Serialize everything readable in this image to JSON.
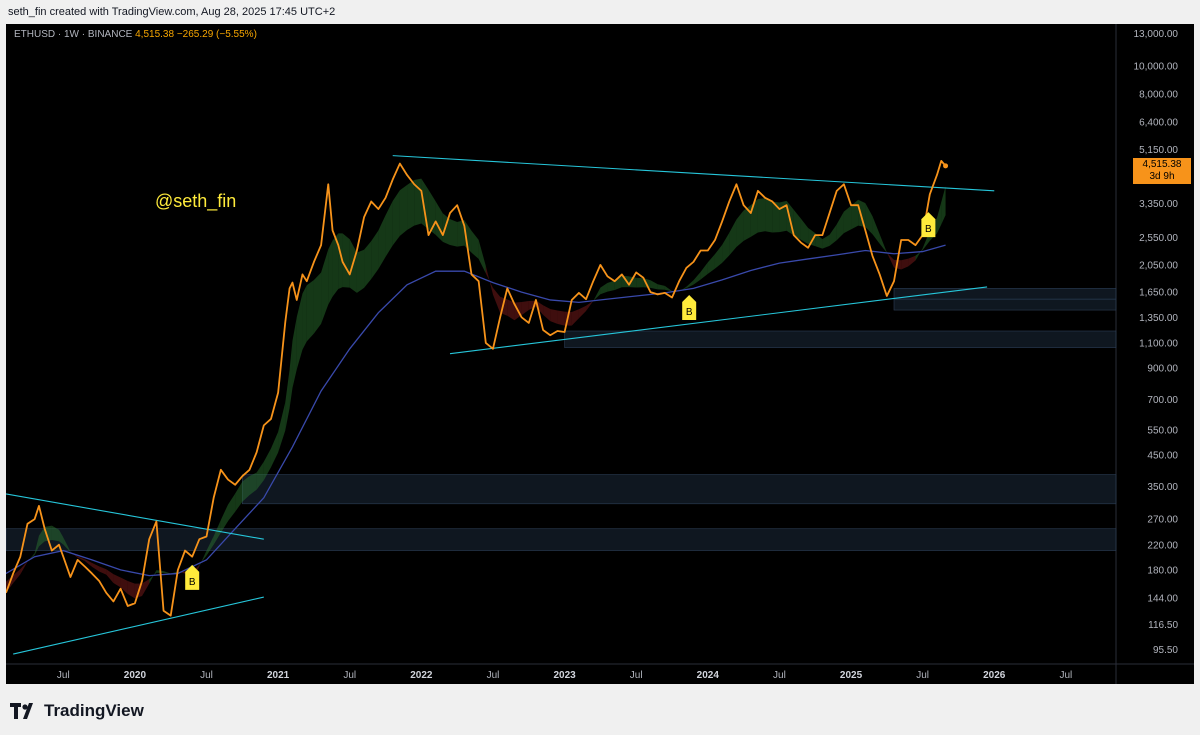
{
  "header": {
    "caption": "seth_fin created with TradingView.com, Aug 28, 2025 17:45 UTC+2"
  },
  "legend": {
    "symbol": "ETHUSD · 1W · BINANCE",
    "price": "4,515.38",
    "change": "−265.29 (−5.55%)"
  },
  "watermark_user": "@seth_fin",
  "price_tag": {
    "price": "4,515.38",
    "countdown": "3d 9h"
  },
  "footer": {
    "brand": "TradingView",
    "logo_icon": "tradingview-logo-icon"
  },
  "signal_badges": [
    "B",
    "B",
    "B"
  ],
  "colors": {
    "price_line": "#f7931a",
    "trendline": "#26c6da",
    "ma_slow": "#3949ab",
    "cloud_bull": "#2e7d32",
    "cloud_bear": "#8b1e1e",
    "badge": "#ffeb3b",
    "zone": "#1c2a3a"
  },
  "chart_data": {
    "type": "line",
    "scale": "log",
    "ylim": [
      85,
      14000
    ],
    "y_ticks": [
      "13,000.00",
      "10,000.00",
      "8,000.00",
      "6,400.00",
      "5,150.00",
      "3,350.00",
      "2,550.00",
      "2,050.00",
      "1,650.00",
      "1,350.00",
      "1,100.00",
      "900.00",
      "700.00",
      "550.00",
      "450.00",
      "350.00",
      "270.00",
      "220.00",
      "180.00",
      "144.00",
      "116.50",
      "95.50"
    ],
    "y_tick_values": [
      13000,
      10000,
      8000,
      6400,
      5150,
      3350,
      2550,
      2050,
      1650,
      1350,
      1100,
      900,
      700,
      550,
      450,
      350,
      270,
      220,
      180,
      144,
      116.5,
      95.5
    ],
    "x_ticks": [
      "Jul",
      "2020",
      "Jul",
      "2021",
      "Jul",
      "2022",
      "Jul",
      "2023",
      "Jul",
      "2024",
      "Jul",
      "2025",
      "Jul",
      "2026",
      "Jul"
    ],
    "x_tick_values": [
      2019.5,
      2020.0,
      2020.5,
      2021.0,
      2021.5,
      2022.0,
      2022.5,
      2023.0,
      2023.5,
      2024.0,
      2024.5,
      2025.0,
      2025.5,
      2026.0,
      2026.5
    ],
    "xlim": [
      2019.1,
      2026.85
    ],
    "series": [
      {
        "points": [
          [
            2019.1,
            150
          ],
          [
            2019.15,
            175
          ],
          [
            2019.2,
            200
          ],
          [
            2019.25,
            260
          ],
          [
            2019.3,
            270
          ],
          [
            2019.33,
            300
          ],
          [
            2019.37,
            250
          ],
          [
            2019.42,
            210
          ],
          [
            2019.47,
            220
          ],
          [
            2019.5,
            200
          ],
          [
            2019.55,
            170
          ],
          [
            2019.6,
            195
          ],
          [
            2019.65,
            185
          ],
          [
            2019.7,
            175
          ],
          [
            2019.75,
            165
          ],
          [
            2019.8,
            150
          ],
          [
            2019.85,
            140
          ],
          [
            2019.9,
            155
          ],
          [
            2019.95,
            135
          ],
          [
            2020.0,
            138
          ],
          [
            2020.05,
            165
          ],
          [
            2020.1,
            230
          ],
          [
            2020.15,
            265
          ],
          [
            2020.2,
            130
          ],
          [
            2020.25,
            125
          ],
          [
            2020.3,
            180
          ],
          [
            2020.35,
            210
          ],
          [
            2020.4,
            200
          ],
          [
            2020.45,
            230
          ],
          [
            2020.5,
            235
          ],
          [
            2020.55,
            320
          ],
          [
            2020.6,
            400
          ],
          [
            2020.65,
            370
          ],
          [
            2020.7,
            355
          ],
          [
            2020.75,
            380
          ],
          [
            2020.8,
            400
          ],
          [
            2020.85,
            460
          ],
          [
            2020.9,
            570
          ],
          [
            2020.95,
            600
          ],
          [
            2021.0,
            740
          ],
          [
            2021.05,
            1300
          ],
          [
            2021.08,
            1700
          ],
          [
            2021.1,
            1780
          ],
          [
            2021.13,
            1550
          ],
          [
            2021.17,
            1900
          ],
          [
            2021.2,
            1800
          ],
          [
            2021.25,
            2100
          ],
          [
            2021.3,
            2400
          ],
          [
            2021.35,
            3900
          ],
          [
            2021.38,
            2700
          ],
          [
            2021.42,
            2400
          ],
          [
            2021.45,
            2100
          ],
          [
            2021.5,
            1900
          ],
          [
            2021.55,
            2300
          ],
          [
            2021.6,
            3000
          ],
          [
            2021.65,
            3400
          ],
          [
            2021.7,
            3200
          ],
          [
            2021.75,
            3500
          ],
          [
            2021.8,
            4050
          ],
          [
            2021.85,
            4600
          ],
          [
            2021.9,
            4200
          ],
          [
            2021.95,
            3900
          ],
          [
            2022.0,
            3700
          ],
          [
            2022.05,
            2600
          ],
          [
            2022.1,
            2900
          ],
          [
            2022.15,
            2600
          ],
          [
            2022.2,
            3100
          ],
          [
            2022.25,
            3300
          ],
          [
            2022.3,
            2800
          ],
          [
            2022.35,
            1900
          ],
          [
            2022.4,
            1800
          ],
          [
            2022.45,
            1100
          ],
          [
            2022.5,
            1050
          ],
          [
            2022.55,
            1350
          ],
          [
            2022.6,
            1700
          ],
          [
            2022.65,
            1500
          ],
          [
            2022.7,
            1350
          ],
          [
            2022.75,
            1290
          ],
          [
            2022.8,
            1550
          ],
          [
            2022.85,
            1220
          ],
          [
            2022.9,
            1170
          ],
          [
            2022.95,
            1210
          ],
          [
            2023.0,
            1200
          ],
          [
            2023.05,
            1550
          ],
          [
            2023.1,
            1640
          ],
          [
            2023.15,
            1560
          ],
          [
            2023.2,
            1800
          ],
          [
            2023.25,
            2050
          ],
          [
            2023.3,
            1870
          ],
          [
            2023.35,
            1800
          ],
          [
            2023.4,
            1900
          ],
          [
            2023.45,
            1750
          ],
          [
            2023.5,
            1930
          ],
          [
            2023.55,
            1850
          ],
          [
            2023.6,
            1650
          ],
          [
            2023.65,
            1620
          ],
          [
            2023.7,
            1640
          ],
          [
            2023.75,
            1580
          ],
          [
            2023.8,
            1800
          ],
          [
            2023.85,
            2000
          ],
          [
            2023.9,
            2100
          ],
          [
            2023.95,
            2300
          ],
          [
            2024.0,
            2300
          ],
          [
            2024.05,
            2500
          ],
          [
            2024.1,
            2900
          ],
          [
            2024.15,
            3400
          ],
          [
            2024.2,
            3900
          ],
          [
            2024.25,
            3300
          ],
          [
            2024.3,
            3100
          ],
          [
            2024.35,
            3700
          ],
          [
            2024.4,
            3500
          ],
          [
            2024.45,
            3400
          ],
          [
            2024.5,
            3200
          ],
          [
            2024.55,
            3300
          ],
          [
            2024.6,
            2600
          ],
          [
            2024.65,
            2450
          ],
          [
            2024.7,
            2350
          ],
          [
            2024.75,
            2600
          ],
          [
            2024.8,
            2600
          ],
          [
            2024.85,
            3100
          ],
          [
            2024.9,
            3700
          ],
          [
            2024.95,
            3900
          ],
          [
            2025.0,
            3300
          ],
          [
            2025.05,
            3300
          ],
          [
            2025.1,
            2700
          ],
          [
            2025.15,
            2200
          ],
          [
            2025.2,
            1900
          ],
          [
            2025.25,
            1600
          ],
          [
            2025.3,
            1800
          ],
          [
            2025.35,
            2500
          ],
          [
            2025.4,
            2500
          ],
          [
            2025.45,
            2400
          ],
          [
            2025.5,
            2600
          ],
          [
            2025.55,
            3600
          ],
          [
            2025.6,
            4200
          ],
          [
            2025.63,
            4700
          ],
          [
            2025.66,
            4515
          ]
        ]
      },
      {
        "points": [
          [
            2019.1,
            175
          ],
          [
            2019.3,
            200
          ],
          [
            2019.5,
            210
          ],
          [
            2019.7,
            195
          ],
          [
            2019.9,
            180
          ],
          [
            2020.1,
            172
          ],
          [
            2020.3,
            175
          ],
          [
            2020.5,
            195
          ],
          [
            2020.7,
            250
          ],
          [
            2020.9,
            320
          ],
          [
            2021.1,
            480
          ],
          [
            2021.3,
            750
          ],
          [
            2021.5,
            1050
          ],
          [
            2021.7,
            1400
          ],
          [
            2021.9,
            1750
          ],
          [
            2022.1,
            1950
          ],
          [
            2022.3,
            1950
          ],
          [
            2022.5,
            1780
          ],
          [
            2022.7,
            1650
          ],
          [
            2022.9,
            1550
          ],
          [
            2023.1,
            1520
          ],
          [
            2023.3,
            1560
          ],
          [
            2023.5,
            1600
          ],
          [
            2023.7,
            1640
          ],
          [
            2023.9,
            1700
          ],
          [
            2024.1,
            1820
          ],
          [
            2024.3,
            1960
          ],
          [
            2024.5,
            2080
          ],
          [
            2024.7,
            2150
          ],
          [
            2024.9,
            2220
          ],
          [
            2025.1,
            2300
          ],
          [
            2025.3,
            2240
          ],
          [
            2025.5,
            2280
          ],
          [
            2025.66,
            2400
          ]
        ]
      }
    ],
    "trendlines": [
      {
        "from": [
          2021.8,
          4900
        ],
        "to": [
          2026.0,
          3700
        ]
      },
      {
        "from": [
          2022.2,
          1010
        ],
        "to": [
          2025.95,
          1720
        ]
      },
      {
        "from": [
          2019.1,
          330
        ],
        "to": [
          2020.9,
          230
        ]
      },
      {
        "from": [
          2019.15,
          92
        ],
        "to": [
          2020.9,
          145
        ]
      }
    ],
    "zones": [
      {
        "x0": 2025.3,
        "x1": 2026.85,
        "y0": 1430,
        "y1": 1560
      },
      {
        "x0": 2025.3,
        "x1": 2026.85,
        "y0": 1560,
        "y1": 1700
      },
      {
        "x0": 2023.0,
        "x1": 2026.85,
        "y0": 1060,
        "y1": 1210
      },
      {
        "x0": 2020.75,
        "x1": 2026.85,
        "y0": 305,
        "y1": 385
      },
      {
        "x0": 2019.1,
        "x1": 2026.85,
        "y0": 210,
        "y1": 250
      }
    ],
    "signals": [
      {
        "label": "B",
        "x": 2020.4,
        "y": 180
      },
      {
        "label": "B",
        "x": 2023.87,
        "y": 1550
      },
      {
        "label": "B",
        "x": 2025.54,
        "y": 3000
      }
    ]
  }
}
